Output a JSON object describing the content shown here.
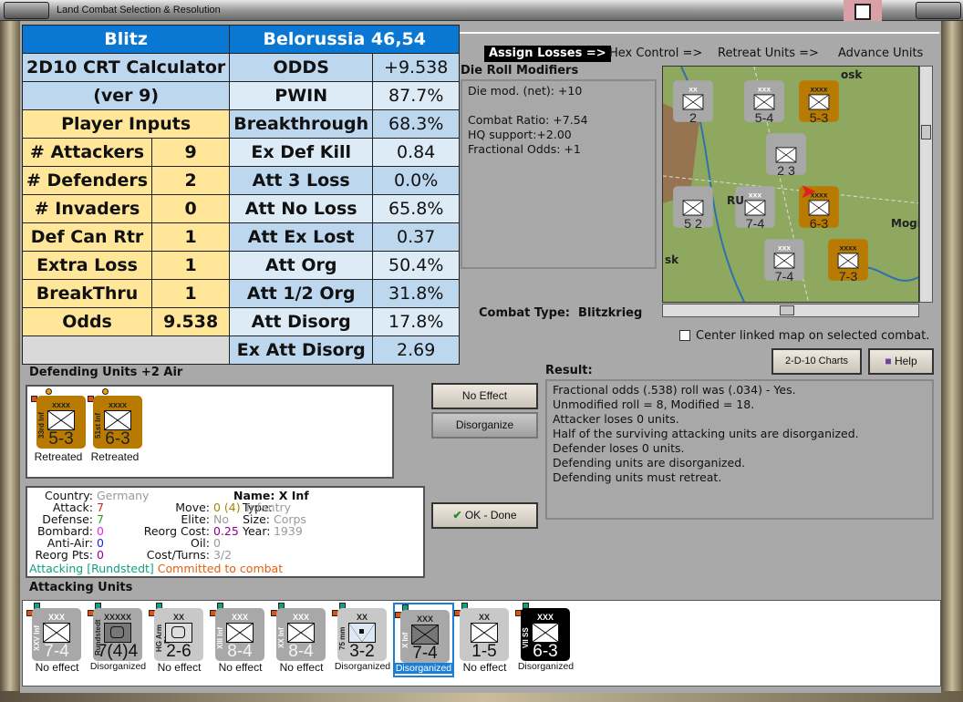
{
  "window": {
    "title": "Land Combat Selection & Resolution"
  },
  "sheet": {
    "header_left": "Blitz",
    "header_right": "Belorussia 46,54",
    "calc_title": "2D10 CRT Calculator",
    "calc_version": "(ver 9)",
    "inputs_title": "Player Inputs",
    "inputs": [
      {
        "label": "# Attackers",
        "value": "9"
      },
      {
        "label": "# Defenders",
        "value": "2"
      },
      {
        "label": "# Invaders",
        "value": "0"
      },
      {
        "label": "Def Can Rtr",
        "value": "1"
      },
      {
        "label": "Extra Loss",
        "value": "1"
      },
      {
        "label": "BreakThru",
        "value": "1"
      },
      {
        "label": "Odds",
        "value": "9.538"
      }
    ],
    "results": [
      {
        "label": "ODDS",
        "value": "+9.538"
      },
      {
        "label": "PWIN",
        "value": "87.7%"
      },
      {
        "label": "Breakthrough",
        "value": "68.3%"
      },
      {
        "label": "Ex Def Kill",
        "value": "0.84"
      },
      {
        "label": "Att 3 Loss",
        "value": "0.0%"
      },
      {
        "label": "Att No Loss",
        "value": "65.8%"
      },
      {
        "label": "Att Ex Lost",
        "value": "0.37"
      },
      {
        "label": "Att Org",
        "value": "50.4%"
      },
      {
        "label": "Att 1/2 Org",
        "value": "31.8%"
      },
      {
        "label": "Att Disorg",
        "value": "17.8%"
      },
      {
        "label": "Ex Att Disorg",
        "value": "2.69"
      }
    ]
  },
  "phases": [
    "Assign Losses =>",
    "Hex Control =>",
    "Retreat Units =>",
    "Advance Units"
  ],
  "die_roll": {
    "title": "Die Roll Modifiers",
    "lines": [
      "Die mod. (net): +10",
      "",
      "Combat Ratio: +7.54",
      "HQ support:+2.00",
      "Fractional Odds: +1"
    ]
  },
  "map": {
    "labels": [
      "Mogil",
      "sk",
      "osk",
      "RU"
    ],
    "counters": [
      {
        "size": "xx",
        "str": "2"
      },
      {
        "size": "xxx",
        "str": "5-4"
      },
      {
        "size": "xxxx",
        "str": "5-3"
      },
      {
        "size": "",
        "str": "2 3"
      },
      {
        "size": "",
        "str": "5 2"
      },
      {
        "size": "xxx",
        "str": "7-4"
      },
      {
        "size": "xxxx",
        "str": "6-3"
      },
      {
        "size": "xxx",
        "str": "7-4"
      },
      {
        "size": "xxxx",
        "str": "7-3"
      }
    ]
  },
  "combat_type": {
    "label": "Combat Type:",
    "value": "Blitzkrieg"
  },
  "center_map": {
    "label": "Center linked map on selected combat.",
    "checked": false
  },
  "buttons": {
    "charts": "2-D-10 Charts",
    "help": "Help",
    "no_effect": "No Effect",
    "disorganize": "Disorganize",
    "ok": "OK - Done"
  },
  "result": {
    "title": "Result:",
    "lines": [
      "Fractional odds (.538) roll was (.034)  - Yes.",
      "Unmodified roll = 8, Modified = 18.",
      "Attacker loses 0 units.",
      "Half of the surviving attacking units are disorganized.",
      "Defender loses 0 units.",
      "Defending units are disorganized.",
      "Defending units must retreat."
    ]
  },
  "defending": {
    "title": "Defending Units +2 Air",
    "units": [
      {
        "name": "33rd Inf",
        "size": "xxxx",
        "str": "5-3",
        "status": "Retreated"
      },
      {
        "name": "51st Inf",
        "size": "xxxx",
        "str": "6-3",
        "status": "Retreated"
      }
    ]
  },
  "info": {
    "country": [
      "Country:",
      "Germany"
    ],
    "attack": [
      "Attack:",
      "7"
    ],
    "defense": [
      "Defense:",
      "7"
    ],
    "bombard": [
      "Bombard:",
      "0"
    ],
    "antiair": [
      "Anti-Air:",
      "0"
    ],
    "reorgpts": [
      "Reorg Pts:",
      "0"
    ],
    "name": [
      "Name:",
      "X Inf"
    ],
    "move": [
      "Move:",
      "0 (4)"
    ],
    "type": [
      "Type:",
      "Infantry"
    ],
    "elite": [
      "Elite:",
      "No"
    ],
    "size": [
      "Size:",
      "Corps"
    ],
    "reorgcost": [
      "Reorg Cost:",
      "0.25"
    ],
    "year": [
      "Year:",
      "1939"
    ],
    "oil": [
      "Oil:",
      "0"
    ],
    "costturns": [
      "Cost/Turns:",
      "3/2"
    ],
    "attacking": "Attacking [Rundstedt]",
    "committed": "Committed to combat"
  },
  "attacking": {
    "title": "Attacking Units",
    "units": [
      {
        "name": "XXV Inf",
        "size": "XXX",
        "str": "7-4",
        "status": "No effect",
        "style": "gray",
        "sym": "x"
      },
      {
        "name": "Rundstedt",
        "size": "XXXXX",
        "str": "7(4)4",
        "status": "Disorganized",
        "style": "hq",
        "sym": "hq"
      },
      {
        "name": "HG Arm Div",
        "size": "XX",
        "str": "2-6",
        "status": "No effect",
        "style": "light",
        "sym": "arm"
      },
      {
        "name": "XIII Inf",
        "size": "XXX",
        "str": "8-4",
        "status": "No effect",
        "style": "gray",
        "sym": "x"
      },
      {
        "name": "XX Inf",
        "size": "XXX",
        "str": "8-4",
        "status": "No effect",
        "style": "gray",
        "sym": "x"
      },
      {
        "name": "75 mm",
        "size": "XX",
        "str": "3-2",
        "status": "Disorganized",
        "style": "light",
        "sym": "art"
      },
      {
        "name": "X Inf",
        "size": "XXX",
        "str": "7-4",
        "status": "Disorganized",
        "style": "sel",
        "sym": "x"
      },
      {
        "name": "",
        "size": "XX",
        "str": "1-5",
        "status": "No effect",
        "style": "light",
        "sym": "x"
      },
      {
        "name": "VII SS",
        "size": "XXX",
        "str": "6-3",
        "status": "Disorganized",
        "style": "black",
        "sym": "x"
      }
    ]
  },
  "colors": {
    "header_blue": "#0a78d2",
    "light_blue": "#bdd7ee",
    "yellow": "#ffe699",
    "selected": "#1a7fd6",
    "attacking_green": "#10a080",
    "committed_orange": "#e06010"
  }
}
